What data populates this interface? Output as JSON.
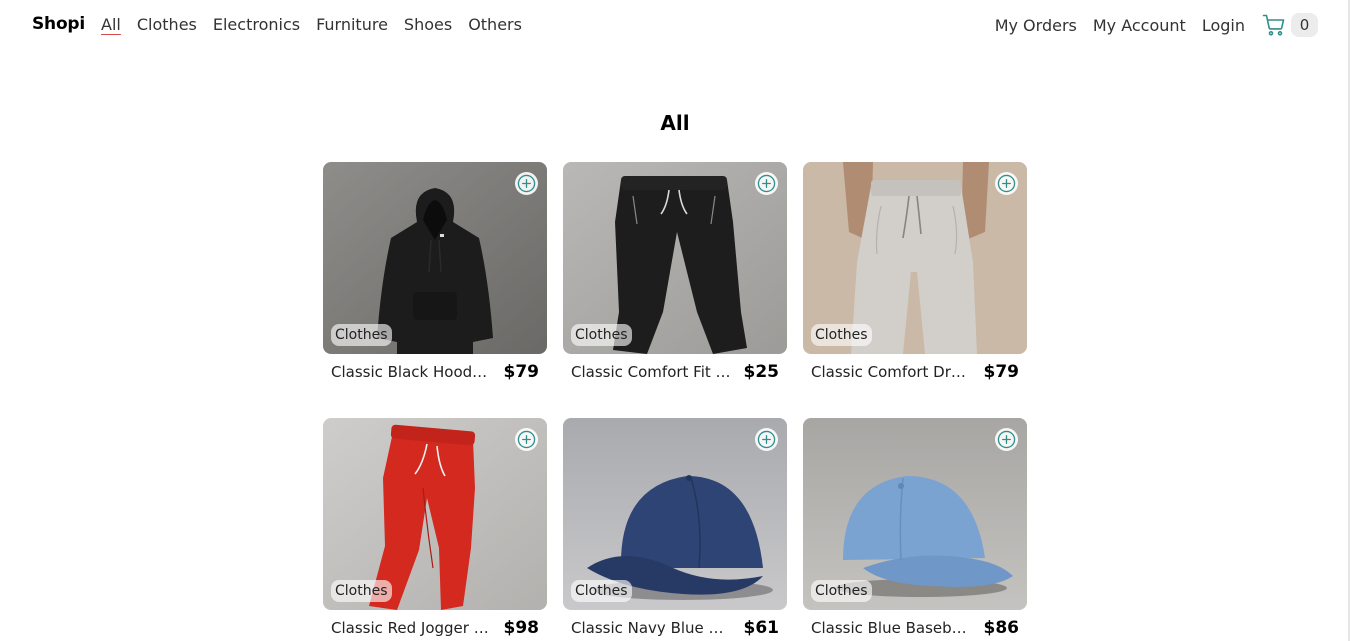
{
  "navbar": {
    "brand": "Shopi",
    "categories": [
      "All",
      "Clothes",
      "Electronics",
      "Furniture",
      "Shoes",
      "Others"
    ],
    "active_category": "All",
    "right_links": [
      "My Orders",
      "My Account",
      "Login"
    ],
    "cart_icon": "shopping-cart-icon",
    "cart_count": "0"
  },
  "page": {
    "title": "All"
  },
  "products": [
    {
      "name": "Classic Black Hooded Sweatshirt",
      "price": "$79",
      "category": "Clothes"
    },
    {
      "name": "Classic Comfort Fit Joggers",
      "price": "$25",
      "category": "Clothes"
    },
    {
      "name": "Classic Comfort Drawstring Joggers",
      "price": "$79",
      "category": "Clothes"
    },
    {
      "name": "Classic Red Jogger Sweatpants",
      "price": "$98",
      "category": "Clothes"
    },
    {
      "name": "Classic Navy Blue Baseball Cap",
      "price": "$61",
      "category": "Clothes"
    },
    {
      "name": "Classic Blue Baseball Cap",
      "price": "$86",
      "category": "Clothes"
    }
  ],
  "icons": {
    "add": "plus-circle-icon"
  },
  "colors": {
    "accent": "#2f8f8a",
    "active_underline": "#d24d4d",
    "text": "#333333"
  }
}
